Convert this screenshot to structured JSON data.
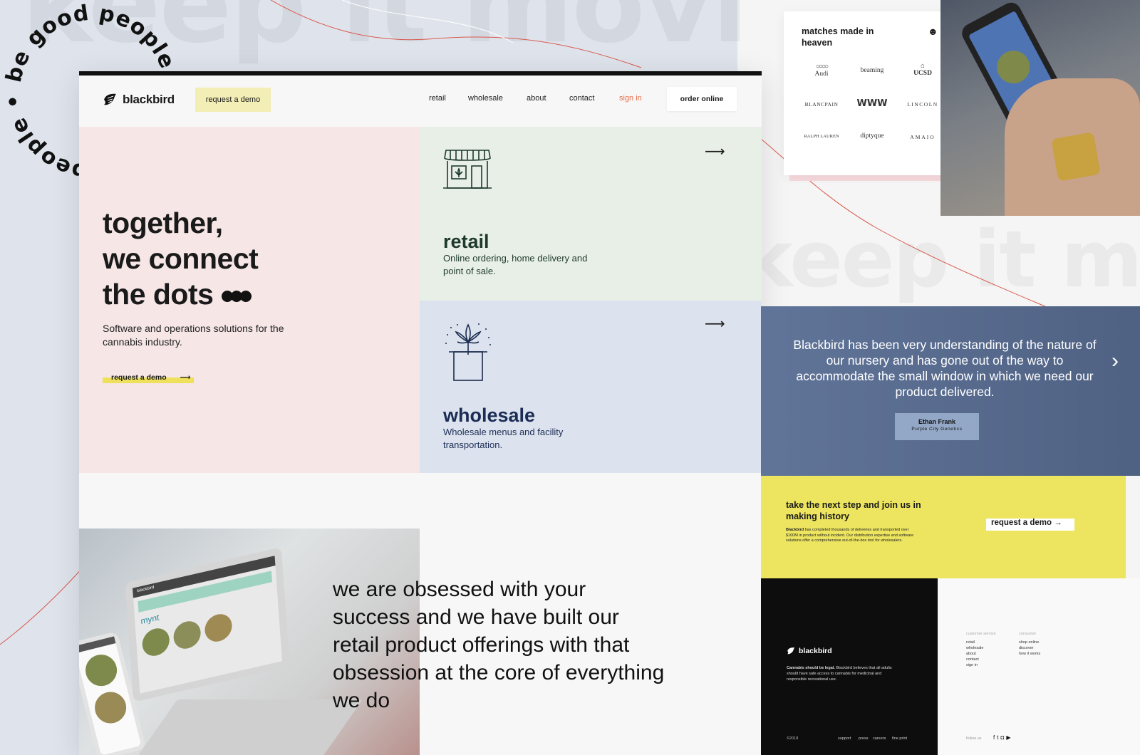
{
  "ghost_text": {
    "top": "keep it movi",
    "right": "keep it mov"
  },
  "circle_text": "be good people • be good people •",
  "nav": {
    "logo": "blackbird",
    "request_demo": "request a demo",
    "links": [
      "retail",
      "wholesale",
      "about",
      "contact"
    ],
    "sign_in": "sign in",
    "order_online": "order online"
  },
  "hero": {
    "title_lines": [
      "together,",
      "we connect",
      "the dots"
    ],
    "subtitle": "Software and operations solutions for the cannabis industry.",
    "cta": "request a demo"
  },
  "retail_card": {
    "title": "retail",
    "description": "Online ordering, home delivery and point of sale.",
    "icon": "storefront-icon"
  },
  "wholesale_card": {
    "title": "wholesale",
    "description": "Wholesale menus and facility transportation.",
    "icon": "box-leaf-icon"
  },
  "obsession": "we are obsessed with your success and we have built our retail product offerings with that obsession at the core of everything we do",
  "laptop_screen": {
    "brand": "blackbird",
    "store": "mynt"
  },
  "brands_card": {
    "title": "matches made in heaven",
    "icon": "smiley-icon",
    "brands": [
      "Audi",
      "beaming",
      "UCSD",
      "BLANCPAIN",
      "WWW",
      "LINCOLN",
      "RALPH LAUREN",
      "diptyque",
      "AMAIO"
    ]
  },
  "testimonial": {
    "quote": "Blackbird has been very understanding of the nature of our nursery and has gone out of the way to accommodate the small window in which we need our product delivered.",
    "name": "Ethan Frank",
    "company": "Purple City Genetics"
  },
  "cta_block": {
    "title": "take the next step and join us in making history",
    "body_bold": "Blackbird",
    "body": "has completed thousands of deliveries and transported over $100M in product without incident. Our distribution expertise and software solutions offer a comprehensive out-of-the-box tool for wholesalers.",
    "button": "request a demo →"
  },
  "footer": {
    "logo": "blackbird",
    "tagline_bold": "Cannabis should be legal.",
    "tagline": "Blackbird believes that all adults should have safe access to cannabis for medicinal and responsible recreational use.",
    "copyright": "©2018",
    "bottom_links": [
      "support",
      "press",
      "careers",
      "fine print"
    ],
    "customer_service_heading": "customer service",
    "customer_service": [
      "retail",
      "wholesale",
      "about",
      "contact",
      "sign in"
    ],
    "consumer_heading": "consumer",
    "consumer": [
      "shop online",
      "discover",
      "how it works"
    ],
    "follow_us": "follow us",
    "social": [
      "facebook-icon",
      "twitter-icon",
      "instagram-icon",
      "youtube-icon"
    ]
  },
  "colors": {
    "pink": "#f6e6e6",
    "green": "#e8efe6",
    "blue_grey": "#dde3ee",
    "yellow": "#ede560",
    "testimonial_blue": "#5a6f95",
    "sign_in_orange": "#e4704e"
  }
}
